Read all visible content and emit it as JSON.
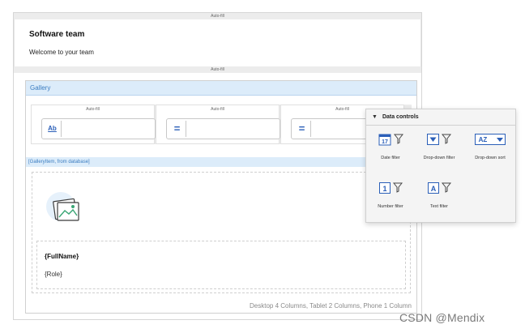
{
  "top_bar": {
    "autofill_label": "Auto-fill"
  },
  "header": {
    "title": "Software team",
    "welcome": "Welcome to your team"
  },
  "second_bar": {
    "autofill_label": "Auto-fill"
  },
  "gallery": {
    "title": "Gallery",
    "filter_cells": [
      {
        "autofill_label": "Auto-fill",
        "icon": "ab-icon",
        "icon_text": "Ab"
      },
      {
        "autofill_label": "Auto-fill",
        "icon": "equals-icon",
        "icon_text": "="
      },
      {
        "autofill_label": "Auto-fill",
        "icon": "equals-icon",
        "icon_text": "="
      }
    ],
    "item_label": "[GalleryItem, from database]",
    "item": {
      "fullname": "{FullName}",
      "role": "{Role}"
    },
    "footer_note": "Desktop 4 Columns, Tablet 2 Columns, Phone 1 Column"
  },
  "data_controls": {
    "title": "Data controls",
    "tools": [
      {
        "label": "Date filter",
        "icon": "calendar-icon",
        "icon_text": "17"
      },
      {
        "label": "Drop-down filter",
        "icon": "dropdown-icon",
        "icon_text": "▼"
      },
      {
        "label": "Drop-down sort",
        "icon": "sort-az-icon",
        "icon_text": "AZ ▼"
      },
      {
        "label": "Number filter",
        "icon": "number-icon",
        "icon_text": "1"
      },
      {
        "label": "Text filter",
        "icon": "text-icon",
        "icon_text": "A"
      }
    ]
  },
  "watermark": "CSDN @Mendix",
  "colors": {
    "accent": "#2b5fb8",
    "gallery_header": "#dcecfa",
    "gallery_text": "#3a7cc0"
  }
}
